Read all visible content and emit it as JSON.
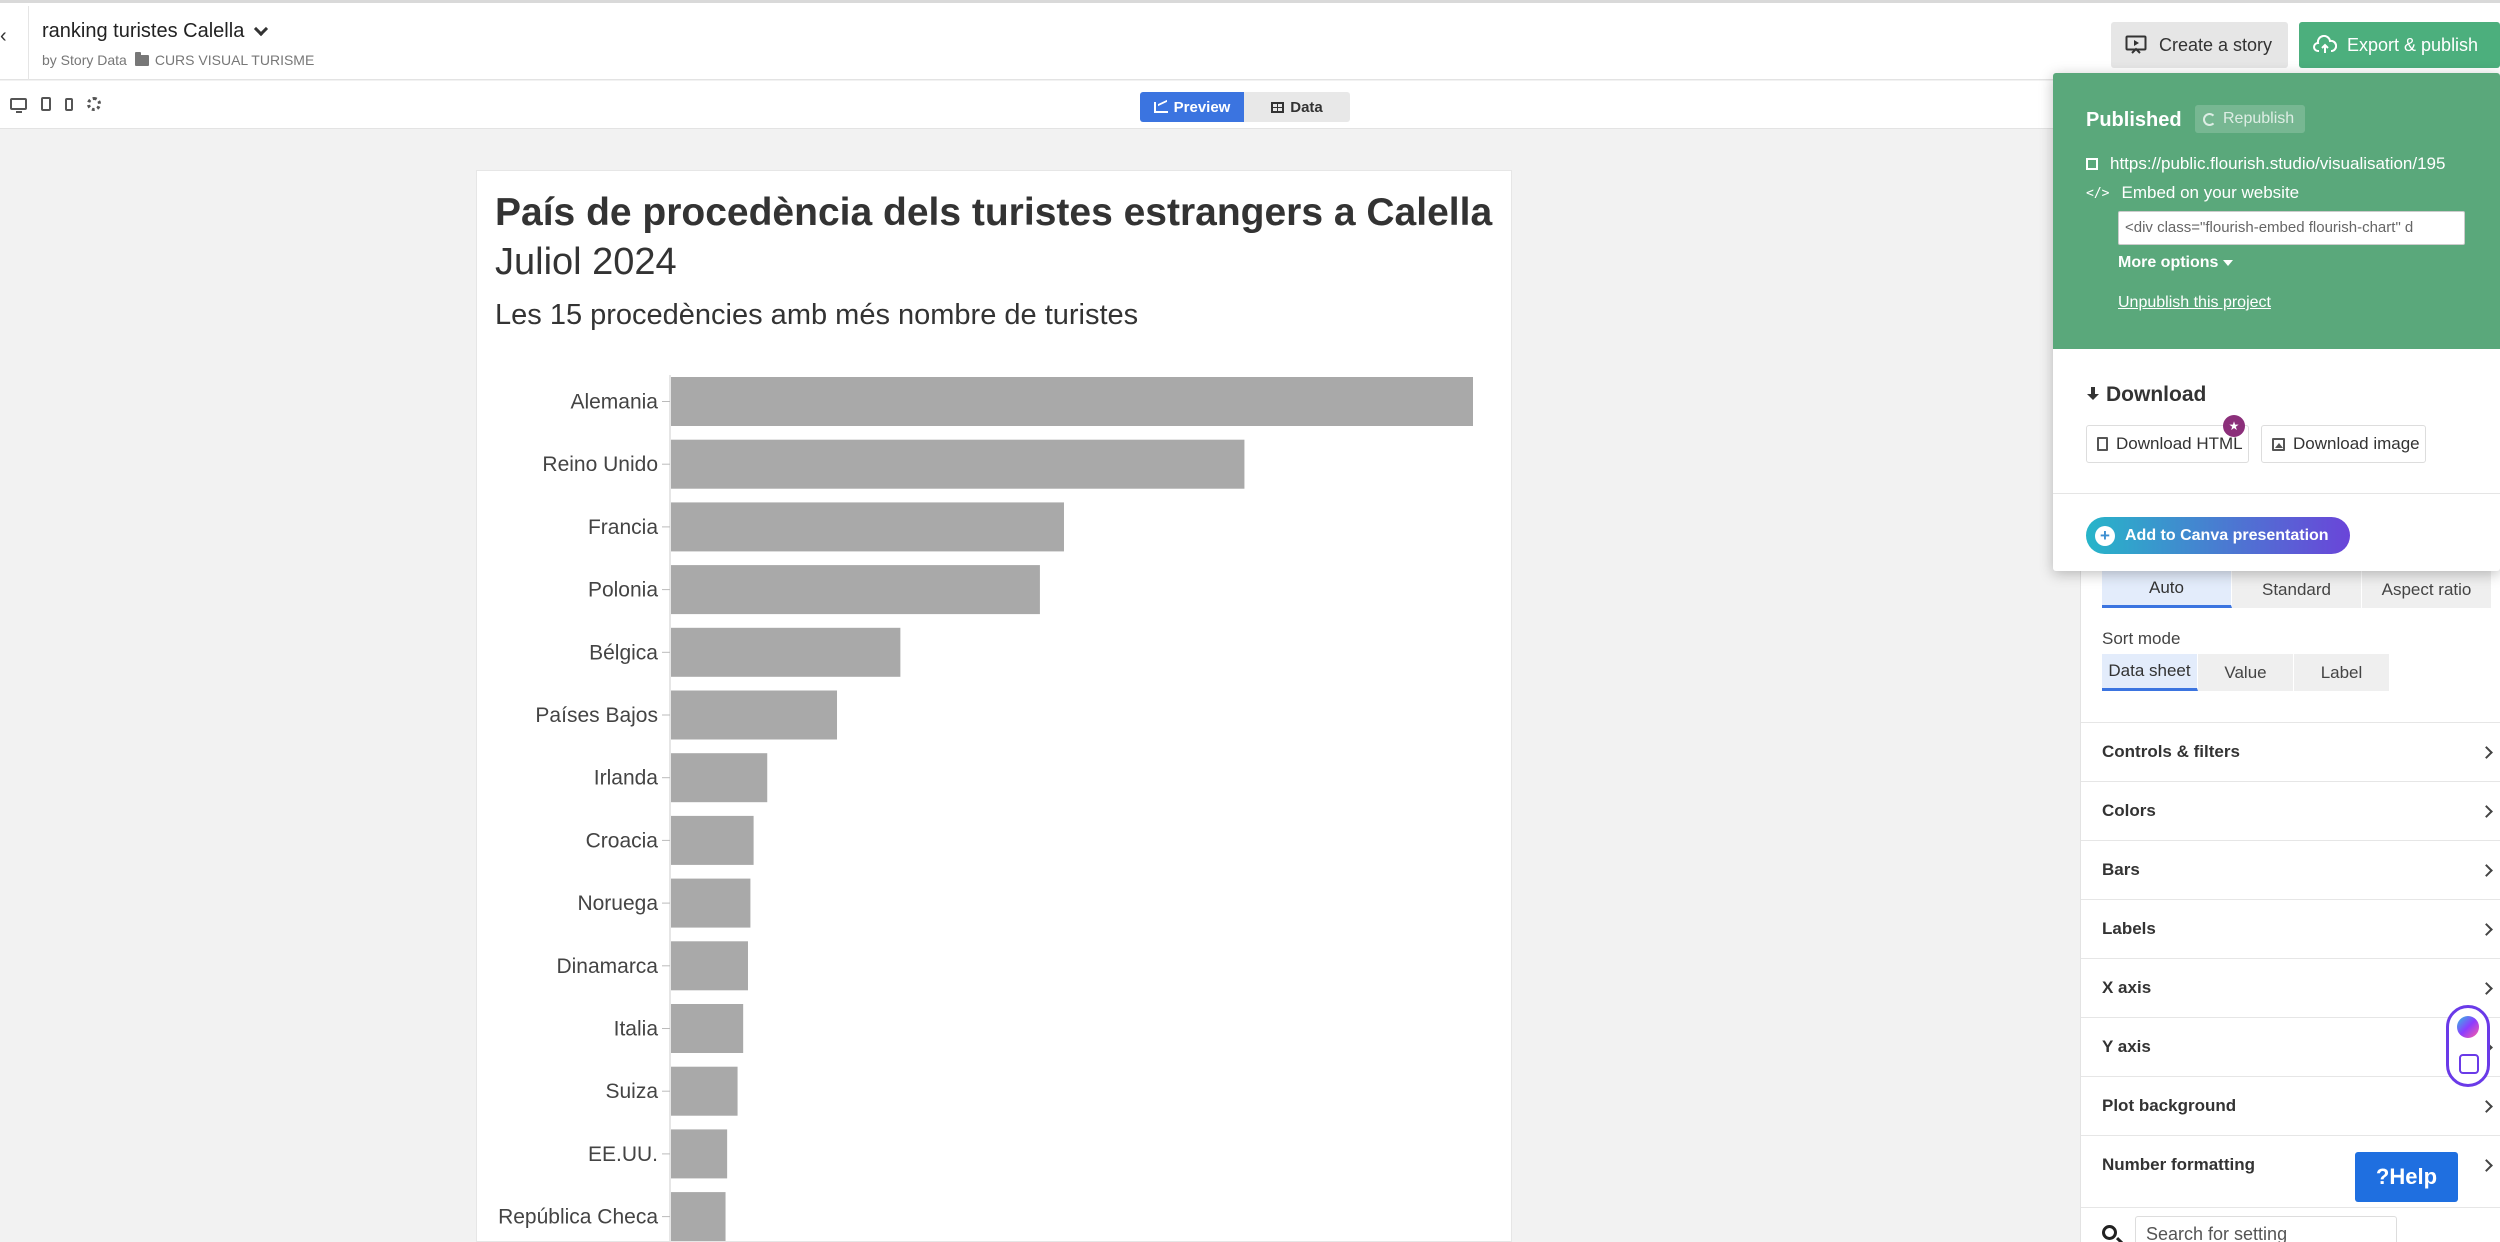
{
  "header": {
    "back_glyph": "‹",
    "project_title": "ranking turistes Calella",
    "byline_prefix": "by Story Data",
    "folder_name": "CURS VISUAL TURISME",
    "create_story_label": "Create a story",
    "export_label": "Export & publish"
  },
  "toolbar": {
    "preview_label": "Preview",
    "data_label": "Data"
  },
  "chart_data": {
    "type": "bar",
    "orientation": "horizontal",
    "title": "País de procedència dels turistes estrangers a Calella",
    "subtitle": "Juliol 2024",
    "description": "Les 15 procedències amb més nombre de turistes",
    "categories": [
      "Alemania",
      "Reino Unido",
      "Francia",
      "Polonia",
      "Bélgica",
      "Países Bajos",
      "Irlanda",
      "Croacia",
      "Noruega",
      "Dinamarca",
      "Italia",
      "Suiza",
      "EE.UU.",
      "República Checa"
    ],
    "values": [
      100,
      71.5,
      49,
      46,
      28.6,
      20.7,
      12,
      10.3,
      9.9,
      9.6,
      9,
      8.3,
      7,
      6.8
    ],
    "bar_color": "#a9a9a9",
    "grid": false,
    "legend": "none"
  },
  "settings": {
    "size_options": [
      "Auto",
      "Standard",
      "Aspect ratio"
    ],
    "size_active": "Auto",
    "sort_mode_label": "Sort mode",
    "sort_options": [
      "Data sheet",
      "Value",
      "Label"
    ],
    "sort_active": "Data sheet",
    "sections": [
      "Controls & filters",
      "Colors",
      "Bars",
      "Labels",
      "X axis",
      "Y axis",
      "Plot background",
      "Number formatting"
    ],
    "search_placeholder": "Search for setting"
  },
  "export_panel": {
    "published_label": "Published",
    "republish_label": "Republish",
    "public_url": "https://public.flourish.studio/visualisation/195",
    "embed_label": "Embed on your website",
    "embed_code": "<div class=\"flourish-embed flourish-chart\" d",
    "more_options_label": "More options",
    "unpublish_label": "Unpublish this project",
    "download_title": "Download",
    "download_html_label": "Download HTML",
    "download_image_label": "Download image",
    "canva_label": "Add to Canva presentation"
  },
  "help_label": "Help",
  "help_glyph": "?",
  "colors": {
    "accent_blue": "#3b74e0",
    "publish_green": "#5aa87b",
    "export_green": "#4caf7d",
    "help_blue": "#1f6fe0"
  }
}
